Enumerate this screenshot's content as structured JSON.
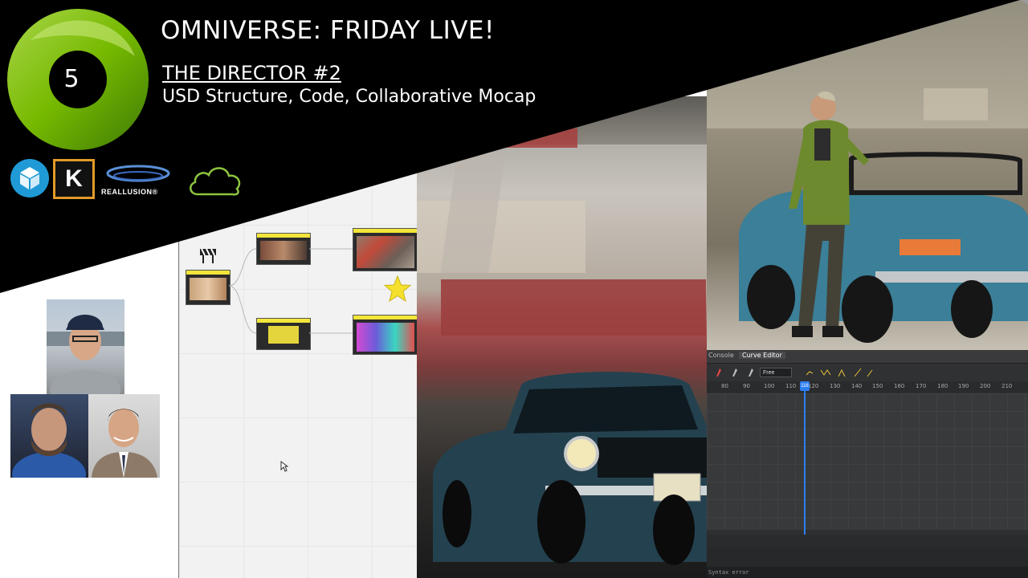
{
  "header": {
    "badge_number": "5",
    "title": "OMNIVERSE: FRIDAY LIVE!",
    "subtitle": "THE DIRECTOR #2",
    "subline": "USD Structure, Code, Collaborative Mocap"
  },
  "logos": {
    "items": [
      {
        "name": "cube-logo"
      },
      {
        "name": "kitbash-k-logo",
        "text": "K"
      },
      {
        "name": "reallusion-logo",
        "text": "REALLUSION®"
      },
      {
        "name": "cloud-logo"
      }
    ]
  },
  "curve_editor": {
    "tabs": [
      "Console",
      "Curve Editor"
    ],
    "interpolation": "Free",
    "ruler_ticks": [
      "80",
      "90",
      "100",
      "110",
      "120",
      "130",
      "140",
      "150",
      "160",
      "170",
      "180",
      "190",
      "200",
      "210"
    ],
    "playhead_frame": "116",
    "status": "Syntax error"
  },
  "colors": {
    "background": "#ffffff",
    "header_black": "#000000",
    "badge_green": "#76b900",
    "node_header_yellow": "#f3e53a",
    "playhead_blue": "#2d7ff0"
  }
}
